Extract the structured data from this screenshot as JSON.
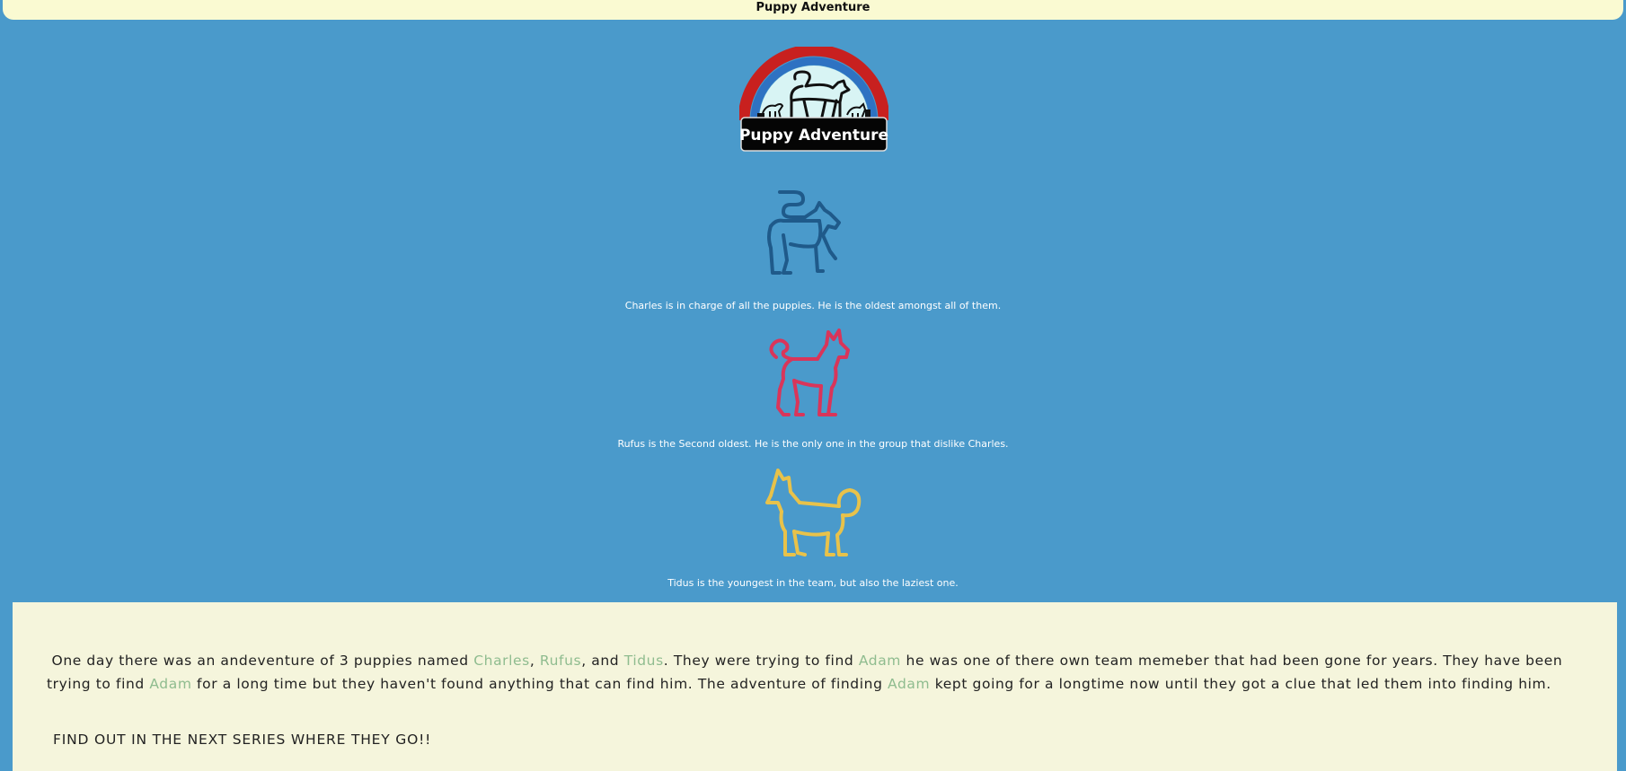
{
  "header": {
    "title": "Puppy Adventure"
  },
  "logo": {
    "text": "Puppy Adventure",
    "icon": "dogs-logo-icon"
  },
  "puppies": [
    {
      "name": "Charles",
      "color": "#1f5a8a",
      "icon": "dog-outline-icon",
      "caption": "Charles is in charge of all the puppies. He is the oldest amongst all of them."
    },
    {
      "name": "Rufus",
      "color": "#d9355a",
      "icon": "dog-outline-icon",
      "caption": "Rufus is the Second oldest. He is the only one in the group that dislike Charles."
    },
    {
      "name": "Tidus",
      "color": "#e8c24a",
      "icon": "dog-outline-icon",
      "caption": "Tidus is the youngest in the team, but also the laziest one."
    }
  ],
  "story": {
    "p1_a": "One day there was an andeventure of 3 puppies named ",
    "name1": "Charles",
    "sep1": ", ",
    "name2": "Rufus",
    "sep2": ", and ",
    "name3": "Tidus",
    "p1_b": ". They were trying to find ",
    "adam1": "Adam",
    "p1_c": " he was one of there own team memeber that had been gone for years. They have been trying to find ",
    "adam2": "Adam",
    "p1_d": " for a long time but they haven't found anything that can find him. The adventure of finding ",
    "adam3": "Adam",
    "p1_e": " kept going for a longtime now until they got a clue that led them into finding him.",
    "series": "FIND OUT IN THE NEXT SERIES WHERE THEY GO!!",
    "highlight_color": "#8fbc8f"
  },
  "colors": {
    "background": "#4a9acb",
    "panel": "#f5f5dc",
    "topbar": "#fafad2"
  }
}
